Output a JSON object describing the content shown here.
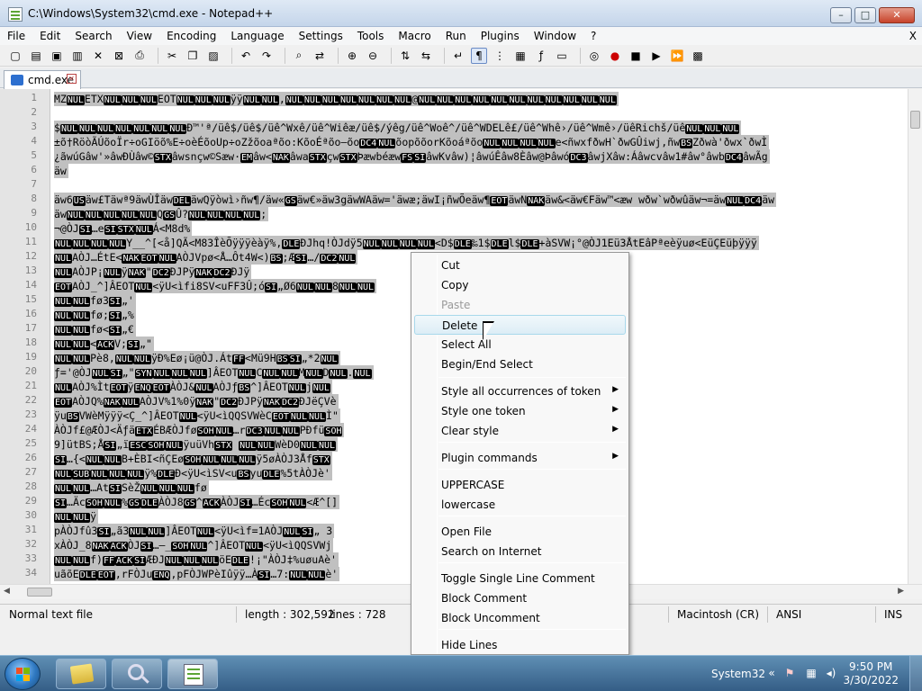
{
  "window": {
    "title": "C:\\Windows\\System32\\cmd.exe - Notepad++",
    "controls": {
      "minimize": "–",
      "maximize": "□",
      "close": "✕"
    }
  },
  "menubar": {
    "items": [
      "File",
      "Edit",
      "Search",
      "View",
      "Encoding",
      "Language",
      "Settings",
      "Tools",
      "Macro",
      "Run",
      "Plugins",
      "Window",
      "?"
    ],
    "close": "X"
  },
  "toolbar": {
    "icons": [
      "new-file-icon",
      "open-icon",
      "save-icon",
      "save-all-icon",
      "close-icon",
      "close-all-icon",
      "print-icon",
      "cut-icon",
      "copy-icon",
      "paste-icon",
      "undo-icon",
      "redo-icon",
      "find-icon",
      "replace-icon",
      "zoom-in-icon",
      "zoom-out-icon",
      "sync-vertical-icon",
      "sync-horizontal-icon",
      "word-wrap-icon",
      "show-all-chars-icon",
      "indent-guide-icon",
      "doc-map-icon",
      "function-list-icon",
      "folder-workspace-icon",
      "monitor-icon",
      "record-macro-icon",
      "stop-macro-icon",
      "play-macro-icon",
      "run-macro-multiple-icon",
      "save-macro-icon"
    ]
  },
  "tabs": [
    {
      "label": "cmd.exe",
      "close": "✕"
    }
  ],
  "editor": {
    "line_numbers": [
      "1",
      "2",
      "3",
      "4",
      "5",
      "6",
      "7",
      "8",
      "9",
      "10",
      "11",
      "12",
      "13",
      "14",
      "15",
      "16",
      "17",
      "18",
      "19",
      "20",
      "21",
      "22",
      "23",
      "24",
      "25",
      "26",
      "27",
      "28",
      "29",
      "30",
      "31",
      "32",
      "33",
      "34"
    ],
    "lines": [
      "MZ[NUL]ETX[NUL][NUL][NUL]EOT[NUL][NUL][NUL]ÿÿ[NUL][NUL],[NUL][NUL][NUL][NUL][NUL][NUL][NUL]@[NUL][NUL][NUL][NUL][NUL][NUL][NUL][NUL][NUL][NUL][NUL]",
      "",
      "$[NUL][NUL][NUL][NUL][NUL][NUL][NUL]Ð™'ª/üê$/üê$/üê^Wxê/üê^Wiêæ/üê$/ýêg/üê^Woê^/üê^WDELê£/üê^Whê›/üê^Wmê›/üêRichš/üê[NUL][NUL][NUL]",
      "±õ†RöòÃÚõoÏr÷oGIöõ%E÷oèÉõoUp÷oZžõoaªõo:KõoÉªõo—õo[DC4][NUL]õopõõorKõoáªõo[NUL][NUL][NUL][NUL]e<ñwxfðwH`ðwGÛiwj,ñw[BS]Zðwà'ðwx`ðwÌ",
      "¿ãwúGâw'»âwÐÙâw©[STX]âwsnçw©Sæw·[EM]âw<[NAK]âwa[STX]çw[STX]Þæwbéæw[FS][SI]âwKvâw)¦âwúÊâw8Èâw@Þâwó[DC3]âwjXâw:Áâwcvâw1#âw°âwb[DC4]âwÃg",
      "äw",
      "",
      "äw6[US]äw£Täwª9äwÙÎäw[DEL]äwQÿòwì›ñw¶/äw«[GS]äw€»äw3gäwWAäw='äwæ;äwI¡ñwÕeäw¶[EOT]äwN[NAK]äw&<äw€Fäw™<æw wðw`wðwûäw¬=äw[NUL][DC4]äw",
      "äw[NUL][NUL][NUL][NUL][NUL]Q[GS]Û?[NUL][NUL][NUL][NUL];",
      "¬@ÒJ[SI]…e[SI][STX][NUL]Á<M8d%",
      "[NUL][NUL][NUL][NUL]Y__^[<å]QÃ<M83ÎèÕÿÿÿèàÿ%,[DLE]ÐJhq!ÒJdÿ5[NUL][NUL][NUL][NUL]<D$[DLE]‰1$[DLE]l$[DLE]+àSVW¡°@ÒJ1Eü3ÅtEâPªeèÿuø<EüÇEüþÿÿÿ",
      "[NUL]AÒJ…ÉtE<[NAK][EOT][NUL]AÒJVpø<Å…Ôt4W<)[BS];Æ[SI]…/[DC2][NUL]",
      "[NUL]AÒJP¡[NUL]ÿ[NAK]\"[DC2]ÐJPÿ[NAK][DC2]ÐJÿ",
      "[EOT]AÒJ_^]ÂEOT[NUL]<ÿU<ìfi8SV<uFF3Û;ó[SI]„Ø6[NUL][NUL]8[NUL][NUL]",
      "[NUL][NUL]fø3[SI]„'",
      "[NUL][NUL]fø;[SI]„%",
      "[NUL][NUL]fø<[SI]„€",
      "[NUL][NUL]<[ACK]V;[SI]„\"",
      "[NUL][NUL]Pè8,[NUL][NUL]ÿÐ%Eø¡ü@ÒJ.Át[FF]<Mü9H[BS][SI]„*2[NUL]",
      "ƒ='@ÒJ[NUL][SI]„\"[SYN][NUL][NUL][NUL]]ÂEOT[NUL]C[NUL][NUL]M[NUL]D[NUL].[NUL]",
      "[NUL]AÒJ%Ìt[EOT]ÿ[ENQ][EOT]ÀÒJ&[NUL]AÒJƒ[BS]^]ÂEOT[NUL]j[NUL]",
      "[EOT]AÒJQ%[NAK][NUL]AÒJV%1%0ÿ[NAK]\"[DC2]ÐJPÿ[NAK][DC2]ÐJëÇVè",
      "ÿu[BS]VWèMÿÿÿ<Ç_^]ÂEOT[NUL]<ÿU<ìQQSVWèC[EOT][NUL][NUL]Ì\"",
      " ÀÒJf£@ÆÒJ<Äƒä[ETX]ÉBÆÒJfø[SOH][NUL]…r[DC3][NUL][NUL]PÐfü[SOH]",
      "9]ütBS;Å[SI]„ï[ESC][SOH][NUL]ÿuüVh[STX] [NUL][NUL]WèD0[NUL][NUL]",
      "[SI]…{<[NUL][NUL]B+ÈBI<ñÇEø[SOH][NUL][NUL][NUL]ÿ5øÀÒJ3Åf[STX]",
      "[NUL][SUB][NUL][NUL][NUL]ÿ%[DLE]Ð<ÿU<ìSV<u[BS]yu[DLE]%5tÀÒJè'",
      "[NUL][NUL]…At[SI]SèŽ[NUL][NUL][NUL]fø",
      "[SI]…Äc[SOH][NUL]%[GS][DLE]ÀÒJ8[GS]^[ACK]ÀÒJ[SI]…Éc[SOH][NUL]<Æ^[]",
      "[NUL][NUL]ÿ",
      "pÀÒJfû3[SI]„ã3[NUL][NUL]]ÂEOT[NUL]<ÿU<ìf=1AÒJ[NUL][SI]„ 3",
      "xÀÒJ_8[NAK][ACK]ÒJ[SI]…—_[SOH][NUL]^]ÂEOT[NUL]<ÿU<ìQQSVWj",
      "[NUL][NUL]f)[FF][ACK][SI]ÆÐJ[NUL][NUL][NUL]öE[DLE]!¡\"ÀÒJ‡%uøuAè'",
      "uãõE[DLE][EOT],rFÒJu[ENQ],pFÒJWPèIûÿÿ…À[SI]…7:[NUL][NUL]è'"
    ]
  },
  "statusbar": {
    "filetype": "Normal text file",
    "length": "length : 302,592",
    "lines": "lines : 728",
    "eol": "Macintosh (CR)",
    "encoding": "ANSI",
    "mode": "INS"
  },
  "context_menu": {
    "items": [
      {
        "label": "Cut",
        "state": "normal"
      },
      {
        "label": "Copy",
        "state": "normal"
      },
      {
        "label": "Paste",
        "state": "disabled"
      },
      {
        "label": "Delete",
        "state": "hover"
      },
      {
        "label": "Select All",
        "state": "normal"
      },
      {
        "label": "Begin/End Select",
        "state": "normal"
      },
      {
        "label": "Style all occurrences of token",
        "state": "submenu"
      },
      {
        "label": "Style one token",
        "state": "submenu"
      },
      {
        "label": "Clear style",
        "state": "submenu"
      },
      {
        "label": "Plugin commands",
        "state": "submenu"
      },
      {
        "label": "UPPERCASE",
        "state": "normal"
      },
      {
        "label": "lowercase",
        "state": "normal"
      },
      {
        "label": "Open File",
        "state": "normal"
      },
      {
        "label": "Search on Internet",
        "state": "normal"
      },
      {
        "label": "Toggle Single Line Comment",
        "state": "normal"
      },
      {
        "label": "Block Comment",
        "state": "normal"
      },
      {
        "label": "Block Uncomment",
        "state": "normal"
      },
      {
        "label": "Hide Lines",
        "state": "normal"
      }
    ],
    "submenu_arrow": "▶"
  },
  "taskbar": {
    "tray_label": "System32",
    "time": "9:50 PM",
    "date": "3/30/2022",
    "apps": [
      "windows-explorer-icon",
      "search-icon",
      "notepad-plus-plus-icon"
    ]
  },
  "colors": {
    "selection_bg": "#c0c0c0",
    "control_char_bg": "#000000",
    "taskbar_top": "#5f8fb4",
    "menu_hover": "#dcedf6"
  }
}
